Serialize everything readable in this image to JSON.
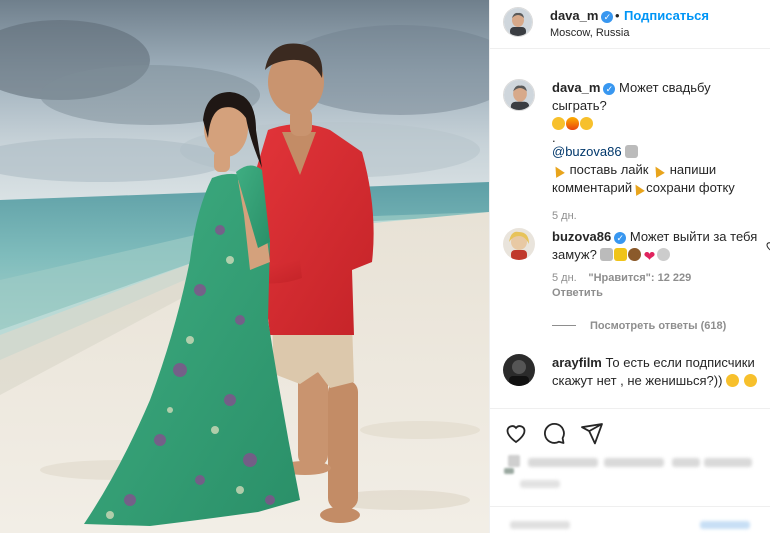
{
  "header": {
    "username": "dava_m",
    "verified_mark": "✓",
    "separator": "•",
    "follow_label": "Подписаться",
    "location": "Moscow, Russia"
  },
  "caption": {
    "username": "dava_m",
    "text": "Может свадьбу сыграть?",
    "dot_line": ".",
    "mention": "@buzova86",
    "line2": "поставь лайк",
    "line2b": "напиши",
    "line3": "комментарий",
    "line3b": "сохрани фотку",
    "time": "5 дн."
  },
  "comments": [
    {
      "username": "buzova86",
      "text": "Может выйти за тебя замуж?",
      "time": "5 дн.",
      "likes": "\"Нравится\": 12 229",
      "reply_label": "Ответить",
      "view_replies": "Посмотреть ответы (618)"
    },
    {
      "username": "arayfilm",
      "text": "То есть если подписчики скажут нет , не женишься?))"
    }
  ],
  "icons": {
    "like": "heart-icon",
    "comment": "comment-icon",
    "share": "share-icon",
    "comment_like": "small-heart-icon"
  },
  "colors": {
    "accent": "#0095f6",
    "verified": "#3897f0",
    "text": "#262626",
    "muted": "#8e8e8e"
  }
}
